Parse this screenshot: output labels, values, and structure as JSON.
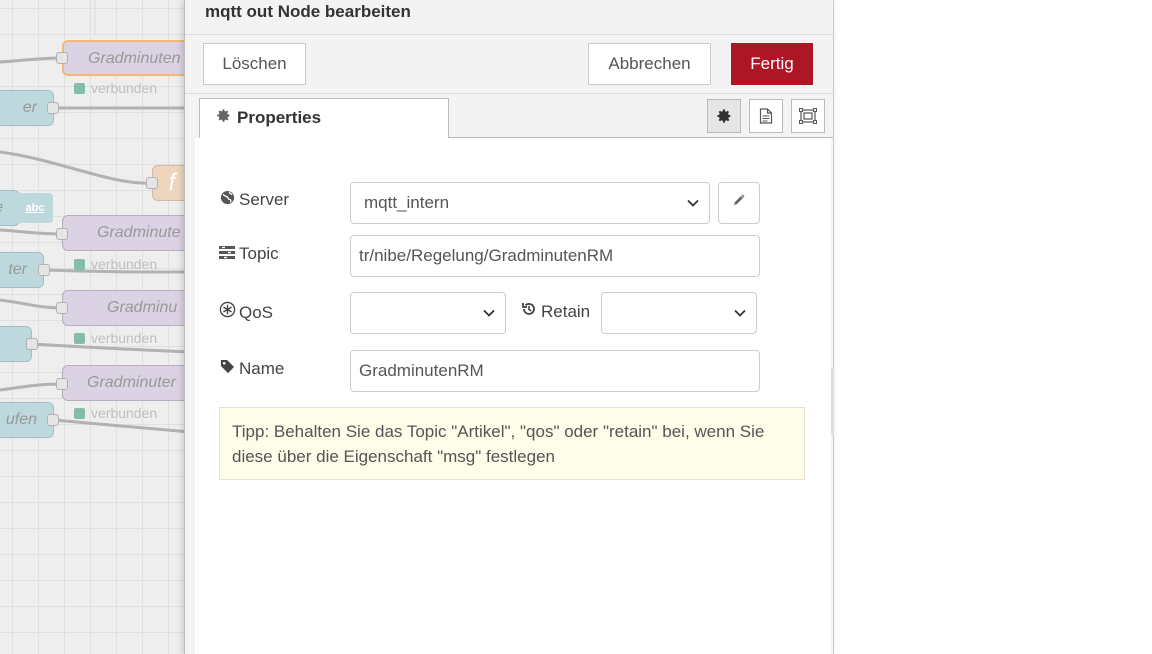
{
  "canvas": {
    "nodes": [
      {
        "label": "Gradminuten",
        "status": "verbunden"
      },
      {
        "label": "Gradminute",
        "status": "verbunden"
      },
      {
        "label": "Gradminu",
        "status": "verbunden"
      },
      {
        "label": "Gradminuter",
        "status": "verbunden"
      }
    ],
    "left_nodes": [
      "er",
      "e",
      "ter",
      "ufen"
    ],
    "abc_label": "abc",
    "function_glyph": "f"
  },
  "dialog": {
    "title": "mqtt out Node bearbeiten",
    "delete_label": "Löschen",
    "cancel_label": "Abbrechen",
    "done_label": "Fertig",
    "tab_label": "Properties",
    "fields": {
      "server_label": "Server",
      "server_value": "mqtt_intern",
      "topic_label": "Topic",
      "topic_value": "tr/nibe/Regelung/GradminutenRM",
      "qos_label": "QoS",
      "qos_value": "",
      "retain_label": "Retain",
      "retain_value": "",
      "name_label": "Name",
      "name_value": "GradminutenRM"
    },
    "tip": "Tipp: Behalten Sie das Topic \"Artikel\", \"qos\" oder \"retain\" bei, wenn Sie diese über die Eigenschaft \"msg\" festlegen"
  },
  "colors": {
    "primary_button": "#ad1625",
    "tip_background": "#fefde9",
    "node_fill": "#cfc3da",
    "teal_node": "#a8ccd2"
  }
}
